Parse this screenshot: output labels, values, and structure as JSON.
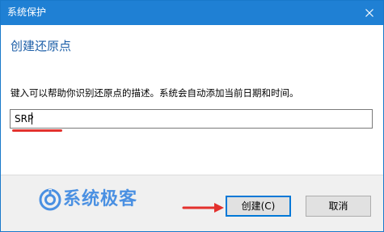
{
  "window": {
    "title": "系统保护"
  },
  "content": {
    "heading": "创建还原点",
    "description": "键入可以帮助你识别还原点的描述。系统会自动添加当前日期和时间。",
    "input_value": "SRP"
  },
  "footer": {
    "logo_text": "系统极客",
    "create_label": "创建(C)",
    "cancel_label": "取消"
  },
  "colors": {
    "titlebar": "#1f80d4",
    "heading": "#1d5fa8",
    "annotation_red": "#e3312d",
    "logo_blue": "#4a90e2"
  },
  "icons": [
    "close-icon",
    "logo-icon",
    "arrow-annotation-icon"
  ]
}
